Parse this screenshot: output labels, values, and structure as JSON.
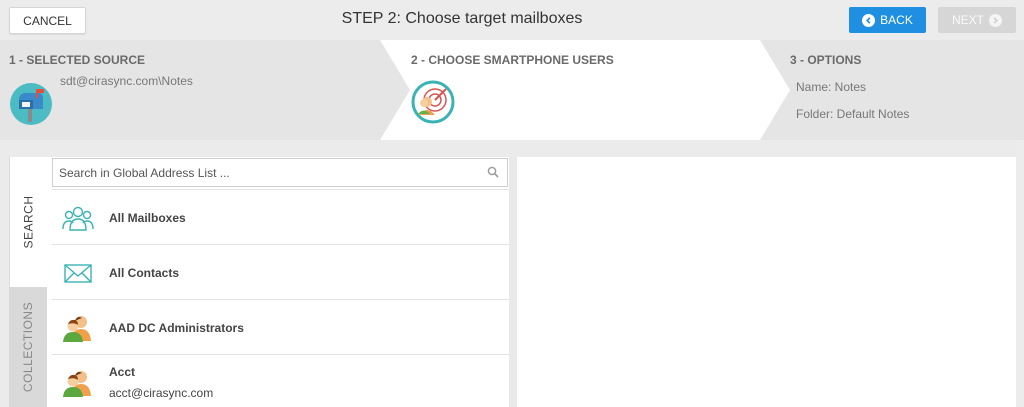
{
  "header": {
    "cancel_label": "CANCEL",
    "title": "STEP 2: Choose target mailboxes",
    "back_label": "BACK",
    "next_label": "NEXT"
  },
  "steps": {
    "step1": {
      "label": "1 - SELECTED SOURCE",
      "source": "sdt@cirasync.com\\Notes"
    },
    "step2": {
      "label": "2 - CHOOSE SMARTPHONE USERS"
    },
    "step3": {
      "label": "3 - OPTIONS",
      "name": "Name: Notes",
      "folder": "Folder: Default Notes"
    }
  },
  "tabs": {
    "search": "SEARCH",
    "collections": "COLLECTIONS"
  },
  "search": {
    "placeholder": "Search in Global Address List ..."
  },
  "list": [
    {
      "name": "All Mailboxes",
      "icon": "group-icon"
    },
    {
      "name": "All Contacts",
      "icon": "envelope-icon"
    },
    {
      "name": "AAD DC Administrators",
      "icon": "users-icon"
    },
    {
      "name": "Acct",
      "email": "acct@cirasync.com",
      "icon": "users-icon"
    }
  ],
  "colors": {
    "accent": "#1e8fe1",
    "teal": "#3bb3b5",
    "disabled": "#d6d6d6",
    "active_step": "#ffffff"
  }
}
